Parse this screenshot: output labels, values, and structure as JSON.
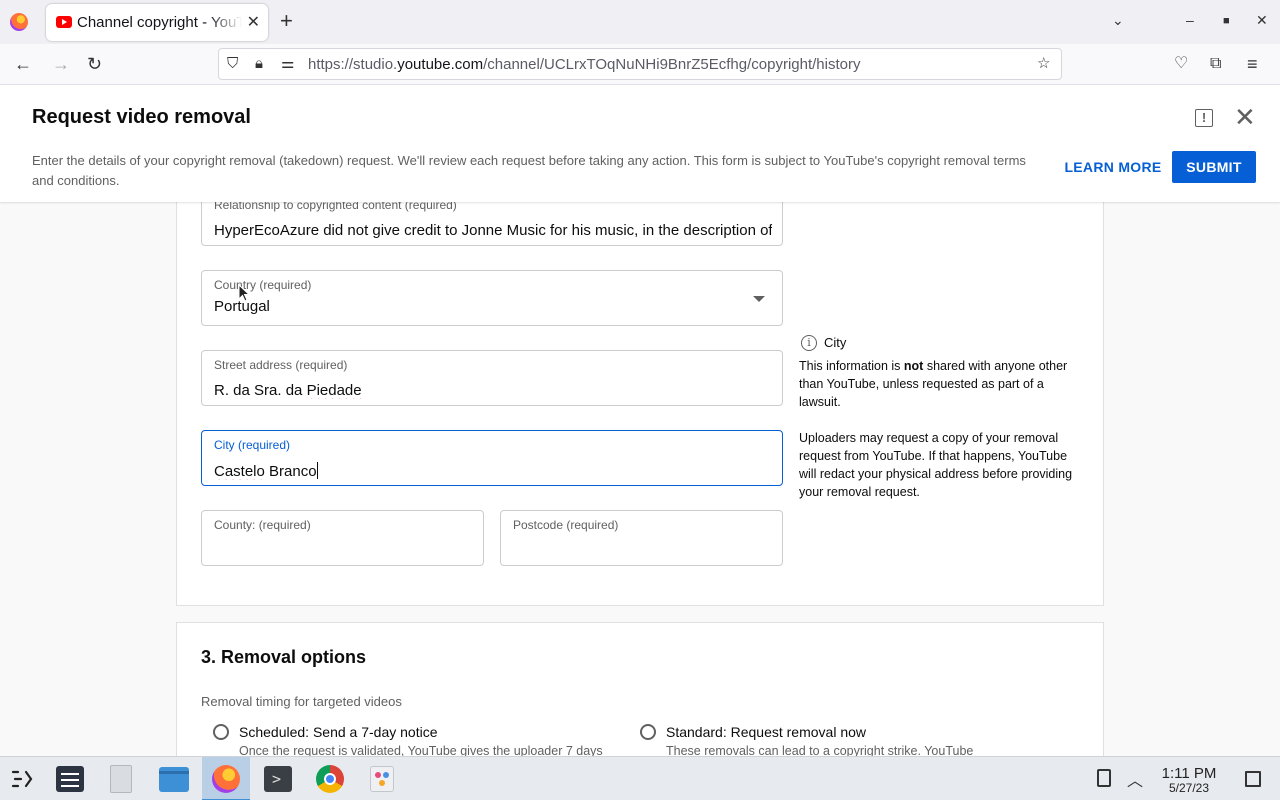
{
  "browser": {
    "tab_title": "Channel copyright - YouTube Studio",
    "url_prefix": "https://studio.",
    "url_domain": "youtube.com",
    "url_path": "/channel/UCLrxTOqNuNHi9BnrZ5Ecfhg/copyright/history"
  },
  "dialog": {
    "title": "Request video removal",
    "description": "Enter the details of your copyright removal (takedown) request. We'll review each request before taking any action. This form is subject to YouTube's copyright removal terms and conditions.",
    "learn_more": "LEARN MORE",
    "submit": "SUBMIT"
  },
  "form": {
    "relationship": {
      "label": "Relationship to copyrighted content (required)",
      "value": "HyperEcoAzure did not give credit to Jonne Music for his music, in the description of the video"
    },
    "country": {
      "label": "Country (required)",
      "value": "Portugal"
    },
    "street": {
      "label": "Street address (required)",
      "value_plain": "R. da Sra. da ",
      "value_misspelled": "Piedade"
    },
    "city": {
      "label": "City (required)",
      "value_misspelled": "Castelo",
      "value_rest": " Branco"
    },
    "county": {
      "label": "County: (required)",
      "value": ""
    },
    "postcode": {
      "label": "Postcode (required)",
      "value": ""
    }
  },
  "info": {
    "title": "City",
    "para1_before": "This information is ",
    "para1_bold": "not",
    "para1_after": " shared with anyone other than YouTube, unless requested as part of a lawsuit.",
    "para2": "Uploaders may request a copy of your removal request from YouTube. If that happens, YouTube will redact your physical address before providing your removal request."
  },
  "removal": {
    "title": "3. Removal options",
    "subtitle": "Removal timing for targeted videos",
    "options": [
      {
        "label": "Scheduled: Send a 7-day notice",
        "desc": "Once the request is validated, YouTube gives the uploader 7 days",
        "selected": false
      },
      {
        "label": "Standard: Request removal now",
        "desc": "These removals can lead to a copyright strike. YouTube",
        "selected": false
      }
    ]
  },
  "taskbar": {
    "time": "1:11 PM",
    "date": "5/27/23",
    "apps": [
      "launcher-icon",
      "system-settings-icon",
      "file-icon",
      "folder-icon",
      "firefox-icon",
      "terminal-icon",
      "chrome-icon",
      "photos-icon"
    ]
  },
  "colors": {
    "accent": "#065fd4",
    "focus_border": "#065fd4",
    "youtube_red": "#ff0000"
  }
}
